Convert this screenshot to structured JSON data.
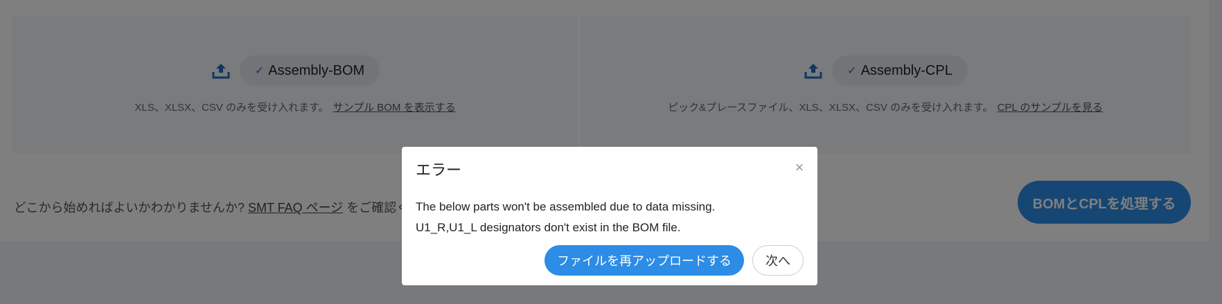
{
  "upload": {
    "bom": {
      "file_label": "Assembly-BOM",
      "hint": "XLS、XLSX、CSV のみを受け入れます。",
      "sample_link": "サンプル BOM を表示する"
    },
    "cpl": {
      "file_label": "Assembly-CPL",
      "hint": "ピック&プレースファイル、XLS、XLSX、CSV のみを受け入れます。",
      "sample_link": "CPL のサンプルを見る"
    }
  },
  "bottom": {
    "help_prefix": "どこから始めればよいかわかりませんか?",
    "faq_link": "SMT FAQ ページ",
    "help_suffix": "をご確認く",
    "process_button": "BOMとCPLを処理する"
  },
  "modal": {
    "title": "エラー",
    "close": "×",
    "line1": "The below parts won't be assembled due to data missing.",
    "line2": "U1_R,U1_L designators don't exist in the BOM file.",
    "reupload_button": "ファイルを再アップロードする",
    "next_button": "次へ"
  },
  "colors": {
    "accent": "#2c8ce6",
    "icon_blue": "#1e6fc2",
    "overlay": "rgba(0,0,0,0.5)"
  },
  "icons": [
    "upload-icon",
    "check-icon",
    "close-icon"
  ]
}
